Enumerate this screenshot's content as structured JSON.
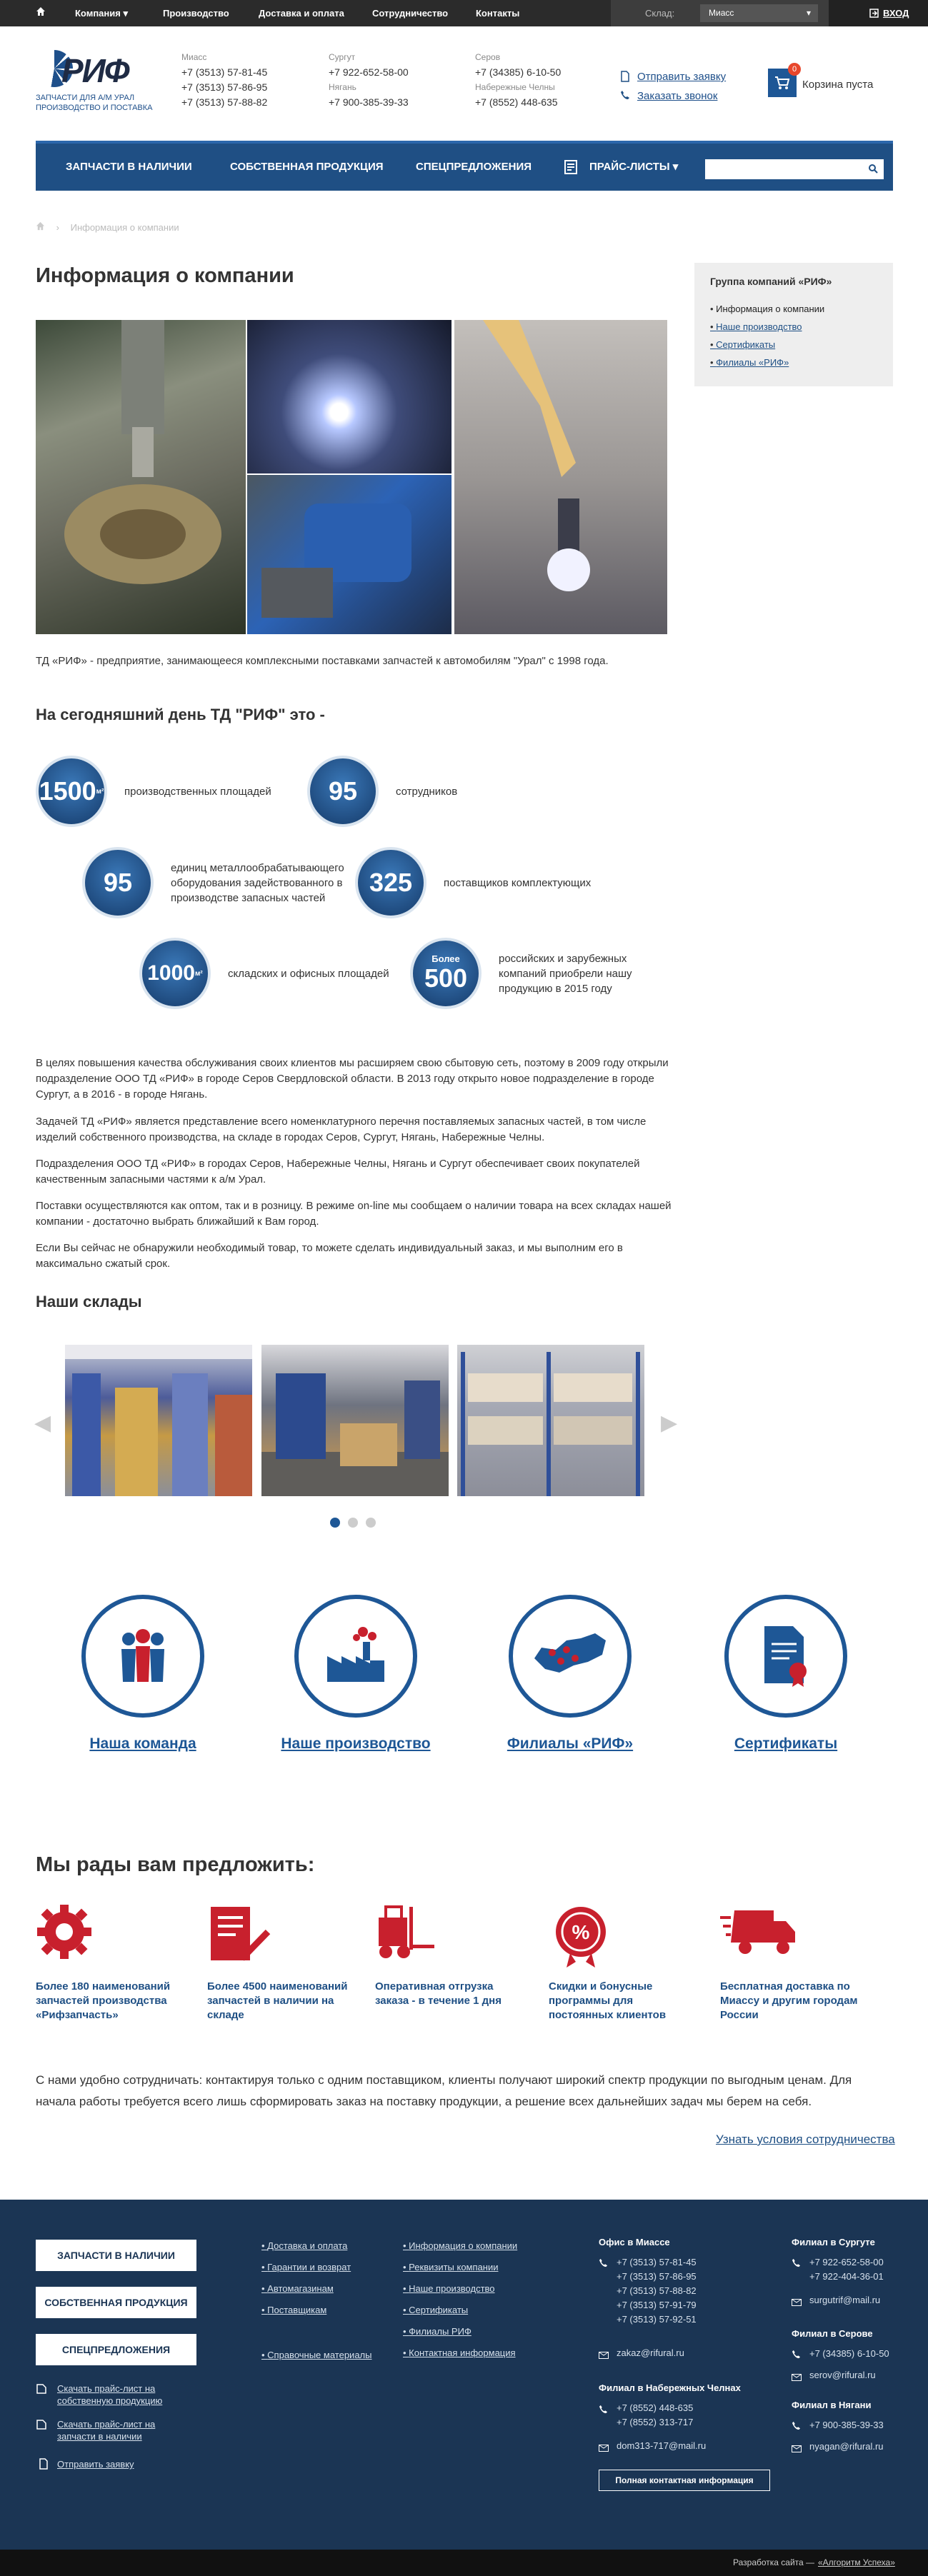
{
  "topbar": {
    "menu": [
      "Компания",
      "Производство",
      "Доставка и оплата",
      "Сотрудничество",
      "Контакты"
    ],
    "stock_label": "Склад:",
    "stock_value": "Миасс",
    "login": "ВХОД"
  },
  "header": {
    "logo_word": "РИФ",
    "logo_sub": "ЗАПЧАСТИ ДЛЯ А/М УРАЛ\nПРОИЗВОДСТВО И ПОСТАВКА",
    "contacts": [
      {
        "city": "Миасс",
        "phones": [
          "+7 (3513) 57-81-45",
          "+7 (3513) 57-86-95",
          "+7 (3513) 57-88-82"
        ]
      },
      {
        "city": "Сургут",
        "phones": [
          "+7 922-652-58-00"
        ],
        "city2": "Нягань",
        "phones2": [
          "+7 900-385-39-33"
        ]
      },
      {
        "city": "Серов",
        "phones": [
          "+7 (34385) 6-10-50"
        ],
        "city2": "Набережные Челны",
        "phones2": [
          "+7 (8552) 448-635"
        ]
      }
    ],
    "send_request": "Отправить заявку",
    "order_call": "Заказать звонок",
    "cart_count": "0",
    "cart_label": "Корзина пуста"
  },
  "nav": {
    "items": [
      "ЗАПЧАСТИ В НАЛИЧИИ",
      "СОБСТВЕННАЯ ПРОДУКЦИЯ",
      "СПЕЦПРЕДЛОЖЕНИЯ",
      "ПРАЙС-ЛИСТЫ"
    ]
  },
  "breadcrumb": {
    "current": "Информация о компании"
  },
  "page_title": "Информация о компании",
  "sidebar": {
    "title": "Группа компаний «РИФ»",
    "items": [
      "Информация о компании",
      "Наше производство",
      "Сертификаты",
      "Филиалы «РИФ»"
    ]
  },
  "intro": "ТД «РИФ» - предприятие, занимающееся комплексными поставками запчастей к автомобилям \"Урал\" с 1998 года.",
  "today_title": "На сегодняшний день ТД \"РИФ\" это -",
  "stats": [
    {
      "value": "1500",
      "unit": "м²",
      "pre": "",
      "text": "производственных площадей"
    },
    {
      "value": "95",
      "unit": "",
      "pre": "",
      "text": "сотрудников"
    },
    {
      "value": "95",
      "unit": "",
      "pre": "",
      "text": "единиц металлообрабатывающего оборудования задействованного в производстве запасных частей"
    },
    {
      "value": "325",
      "unit": "",
      "pre": "",
      "text": "поставщиков комплектующих"
    },
    {
      "value": "1000",
      "unit": "м²",
      "pre": "",
      "text": "складских и офисных площадей"
    },
    {
      "value": "500",
      "unit": "",
      "pre": "Более",
      "text": "российских и зарубежных компаний приобрели нашу продукцию в 2015 году"
    }
  ],
  "paragraphs": [
    "В целях повышения качества обслуживания своих клиентов мы расширяем свою сбытовую сеть, поэтому в 2009 году открыли подразделение ООО ТД «РИФ» в городе Серов Свердловской области. В 2013 году открыто новое подразделение в городе Сургут, а в 2016 - в городе Нягань.",
    "Задачей ТД «РИФ» является представление всего номенклатурного перечня поставляемых запасных частей, в том числе изделий собственного производства, на складе в городах Серов, Сургут, Нягань, Набережные Челны.",
    "Подразделения ООО ТД «РИФ» в городах Серов, Набережные Челны, Нягань и Сургут обеспечивает своих покупателей качественным запасными частями к а/м Урал.",
    "Поставки осуществляются как оптом, так и в розницу. В режиме on-line мы сообщаем о наличии товара на всех складах нашей компании - достаточно выбрать ближайший к Вам город.",
    "Если Вы сейчас не обнаружили необходимый товар, то можете сделать индивидуальный заказ, и мы выполним его в максимально сжатый срок."
  ],
  "warehouses_title": "Наши склады",
  "links": [
    "Наша команда",
    "Наше производство",
    "Филиалы «РИФ»",
    "Сертификаты"
  ],
  "offer_title": "Мы рады вам предложить:",
  "offers": [
    "Более 180 наименований запчастей производства «Рифзапчасть»",
    "Более 4500 наименований запчастей в наличии на складе",
    "Оперативная отгрузка заказа - в течение 1 дня",
    "Скидки и бонусные программы для постоянных клиентов",
    "Бесплатная доставка по Миассу и другим городам России"
  ],
  "coop_text": "С нами удобно сотрудничать: контактируя только с одним поставщиком, клиенты получают широкий спектр продукции по выгодным ценам. Для начала работы требуется всего лишь сформировать заказ на поставку продукции, а решение всех дальнейших задач мы берем на себя.",
  "coop_link": "Узнать условия сотрудничества",
  "footer": {
    "buttons": [
      "ЗАПЧАСТИ В НАЛИЧИИ",
      "СОБСТВЕННАЯ ПРОДУКЦИЯ",
      "СПЕЦПРЕДЛОЖЕНИЯ"
    ],
    "download1": "Скачать прайс-лист на собственную продукцию",
    "download2": "Скачать прайс-лист на запчасти в наличии",
    "send": "Отправить заявку",
    "col1": [
      "Доставка и оплата",
      "Гарантии и возврат",
      "Автомагазинам",
      "Поставщикам"
    ],
    "col1b": "Справочные материалы",
    "col2": [
      "Информация о компании",
      "Реквизиты компании",
      "Наше производство",
      "Сертификаты",
      "Филиалы РИФ",
      "Контактная информация"
    ],
    "miass_title": "Офис в Миассе",
    "miass_phones": [
      "+7 (3513) 57-81-45",
      "+7 (3513) 57-86-95",
      "+7 (3513) 57-88-82",
      "+7 (3513) 57-91-79",
      "+7 (3513) 57-92-51"
    ],
    "miass_email": "zakaz@rifural.ru",
    "chelny_title": "Филиал в Набережных Челнах",
    "chelny_phones": [
      "+7 (8552) 448-635",
      "+7 (8552) 313-717"
    ],
    "chelny_email": "dom313-717@mail.ru",
    "full_contacts": "Полная контактная информация",
    "surgut_title": "Филиал в Сургуте",
    "surgut_phones": [
      "+7 922-652-58-00",
      "+7 922-404-36-01"
    ],
    "surgut_email": "surgutrif@mail.ru",
    "serov_title": "Филиал в Серове",
    "serov_phones": [
      "+7 (34385) 6-10-50"
    ],
    "serov_email": "serov@rifural.ru",
    "nyagan_title": "Филиал в Нягани",
    "nyagan_phones": [
      "+7 900-385-39-33"
    ],
    "nyagan_email": "nyagan@rifural.ru"
  },
  "bottom": {
    "text": "Разработка сайта —",
    "link": "«Алгоритм Успеха»"
  },
  "colors": {
    "brand": "#1e4f84",
    "accent": "#c8202d",
    "dark": "#1b3554"
  }
}
